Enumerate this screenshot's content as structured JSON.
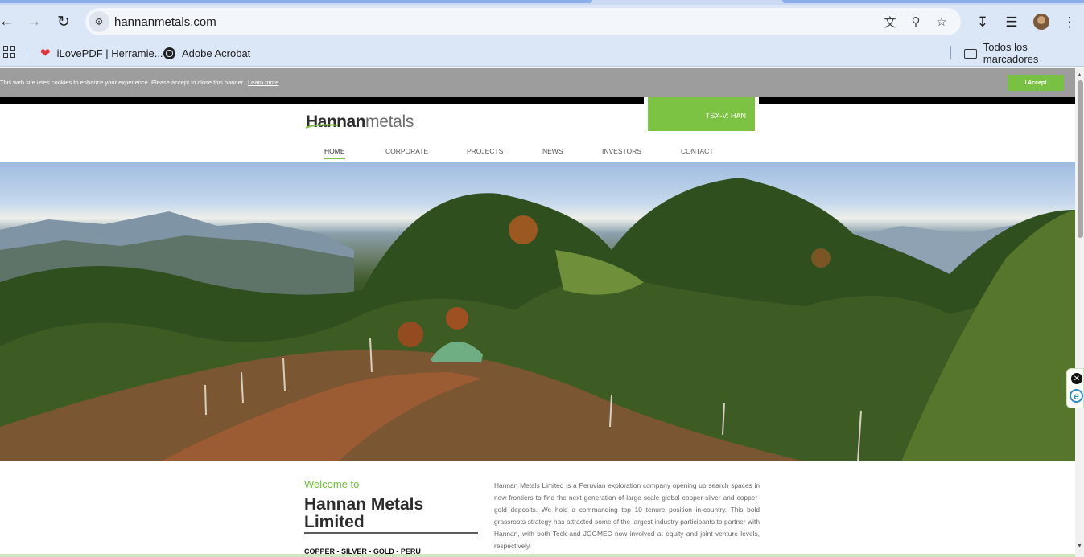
{
  "browser": {
    "url": "hannanmetals.com",
    "icons": [
      "back-icon",
      "forward-icon",
      "reload-icon",
      "site-info-icon",
      "translate-icon",
      "zoom-icon",
      "star-icon",
      "download-icon",
      "media-icon",
      "profile-avatar",
      "menu-icon"
    ],
    "bookmarks": [
      {
        "label": "iLovePDF | Herramie...",
        "icon": "heart-icon"
      },
      {
        "label": "Adobe Acrobat",
        "icon": "globe-icon"
      }
    ],
    "all_bookmarks_label": "Todos los marcadores"
  },
  "cookie_banner": {
    "text": "This web site uses cookies to enhance your experience. Please accept to close this banner.",
    "link": "Learn more",
    "accept": "I Accept"
  },
  "site": {
    "ticker": "TSX-V: HAN",
    "logo_bold": "Hannan",
    "logo_light": "metals",
    "nav": [
      "HOME",
      "CORPORATE",
      "PROJECTS",
      "NEWS",
      "INVESTORS",
      "CONTACT"
    ],
    "active_nav": "HOME",
    "welcome": "Welcome to",
    "title": "Hannan Metals Limited",
    "metals": "COPPER - SILVER - GOLD - PERU",
    "intro": "Hannan Metals Limited is a Peruvian exploration company opening up search spaces in new frontiers to find the next generation of large-scale global copper-silver and copper-gold deposits. We hold a commanding top 10 tenure position in-country. This bold grassroots strategy has attracted some of the largest industry participants to partner with Hannan, with both Teck and JOGMEC now involved at equity and joint venture levels, respectively."
  },
  "colors": {
    "brand_green": "#7cc243",
    "toolbar": "#dbe6f7",
    "cookie_bg": "#9d9d9d"
  }
}
